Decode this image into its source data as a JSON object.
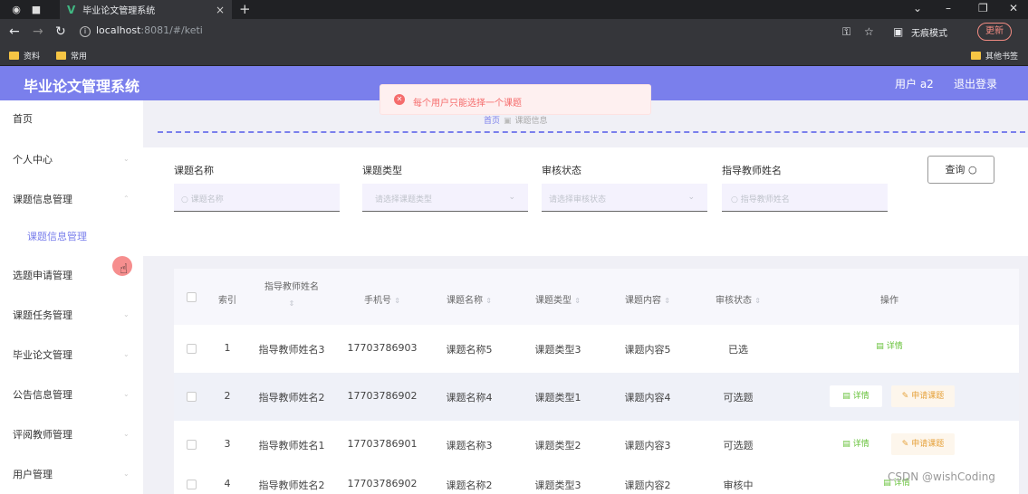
{
  "browser": {
    "tab_title": "毕业论文管理系统",
    "url_host": "localhost",
    "url_path": ":8081/#/keti",
    "incognito_label": "无痕模式",
    "update_label": "更新",
    "bookmarks": [
      "资料",
      "常用"
    ],
    "other_bookmarks": "其他书签"
  },
  "app": {
    "title": "毕业论文管理系统",
    "user_label": "用户 a2",
    "logout_label": "退出登录"
  },
  "sidebar": {
    "items": [
      {
        "label": "首页"
      },
      {
        "label": "个人中心"
      },
      {
        "label": "课题信息管理"
      },
      {
        "label": "课题信息管理"
      },
      {
        "label": "选题申请管理"
      },
      {
        "label": "课题任务管理"
      },
      {
        "label": "毕业论文管理"
      },
      {
        "label": "公告信息管理"
      },
      {
        "label": "评阅教师管理"
      },
      {
        "label": "用户管理"
      }
    ]
  },
  "breadcrumb": {
    "home": "首页",
    "current": "课题信息"
  },
  "toast": {
    "message": "每个用户只能选择一个课题"
  },
  "filters": {
    "name_label": "课题名称",
    "name_placeholder": "课题名称",
    "type_label": "课题类型",
    "type_placeholder": "请选择课题类型",
    "status_label": "审核状态",
    "status_placeholder": "请选择审核状态",
    "teacher_label": "指导教师姓名",
    "teacher_placeholder": "指导教师姓名",
    "query_label": "查询"
  },
  "table": {
    "headers": {
      "index": "索引",
      "teacher": "指导教师姓名",
      "phone": "手机号",
      "name": "课题名称",
      "type": "课题类型",
      "content": "课题内容",
      "status": "审核状态",
      "ops": "操作"
    },
    "detail_label": "详情",
    "apply_label": "申请课题",
    "rows": [
      {
        "index": "1",
        "teacher": "指导教师姓名3",
        "phone": "17703786903",
        "name": "课题名称5",
        "type": "课题类型3",
        "content": "课题内容5",
        "status": "已选"
      },
      {
        "index": "2",
        "teacher": "指导教师姓名2",
        "phone": "17703786902",
        "name": "课题名称4",
        "type": "课题类型1",
        "content": "课题内容4",
        "status": "可选题"
      },
      {
        "index": "3",
        "teacher": "指导教师姓名1",
        "phone": "17703786901",
        "name": "课题名称3",
        "type": "课题类型2",
        "content": "课题内容3",
        "status": "可选题"
      },
      {
        "index": "4",
        "teacher": "指导教师姓名2",
        "phone": "17703786902",
        "name": "课题名称2",
        "type": "课题类型3",
        "content": "课题内容2",
        "status": "审核中"
      }
    ]
  },
  "watermark": "CSDN @wishCoding",
  "colors": {
    "accent": "#7a7fec",
    "error": "#f56c6c",
    "success": "#67c23a",
    "warning": "#e6a23c"
  }
}
